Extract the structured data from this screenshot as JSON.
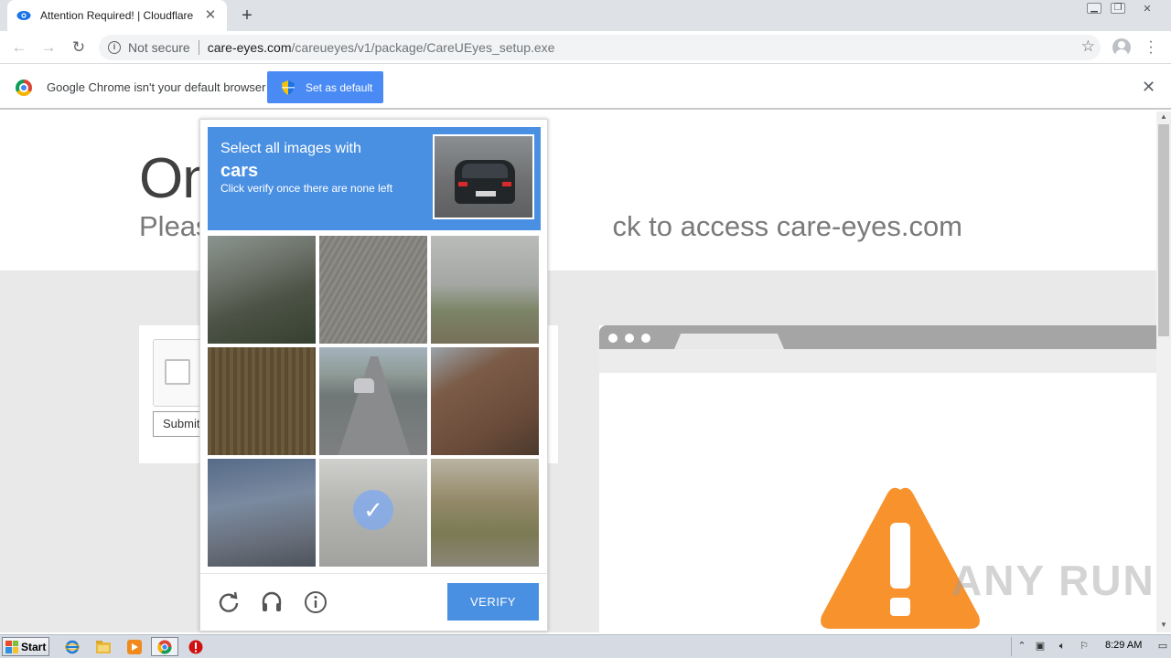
{
  "browser": {
    "tab_title": "Attention Required! | Cloudflare",
    "security_label": "Not secure",
    "url_host": "care-eyes.com",
    "url_path": "/careueyes/v1/package/CareUEyes_setup.exe",
    "infobar_text": "Google Chrome isn't your default browser",
    "set_default_label": "Set as default"
  },
  "page": {
    "heading_visible": "On",
    "subheading_left": "Pleas",
    "subheading_right": "ck to access care-eyes.com",
    "submit_label": "Submit"
  },
  "challenge": {
    "prompt_line1": "Select all images with",
    "prompt_target": "cars",
    "prompt_line3": "Click verify once there are none left",
    "verify_label": "VERIFY",
    "selected_tiles": [
      7
    ],
    "tiles": [
      "bridge-structure",
      "asphalt-texture",
      "parking-garage",
      "brown-wall",
      "highway-with-car",
      "house-roof",
      "overpass",
      "road-selected",
      "grass-roadside"
    ],
    "footer_icons": [
      "refresh-icon",
      "headphones-icon",
      "info-icon"
    ]
  },
  "watermark": "ANY RUN",
  "taskbar": {
    "start_label": "Start",
    "clock": "8:29 AM"
  },
  "colors": {
    "challenge_blue": "#4a90e2",
    "infobar_button": "#4a8af4",
    "warning_orange": "#f7922d"
  }
}
